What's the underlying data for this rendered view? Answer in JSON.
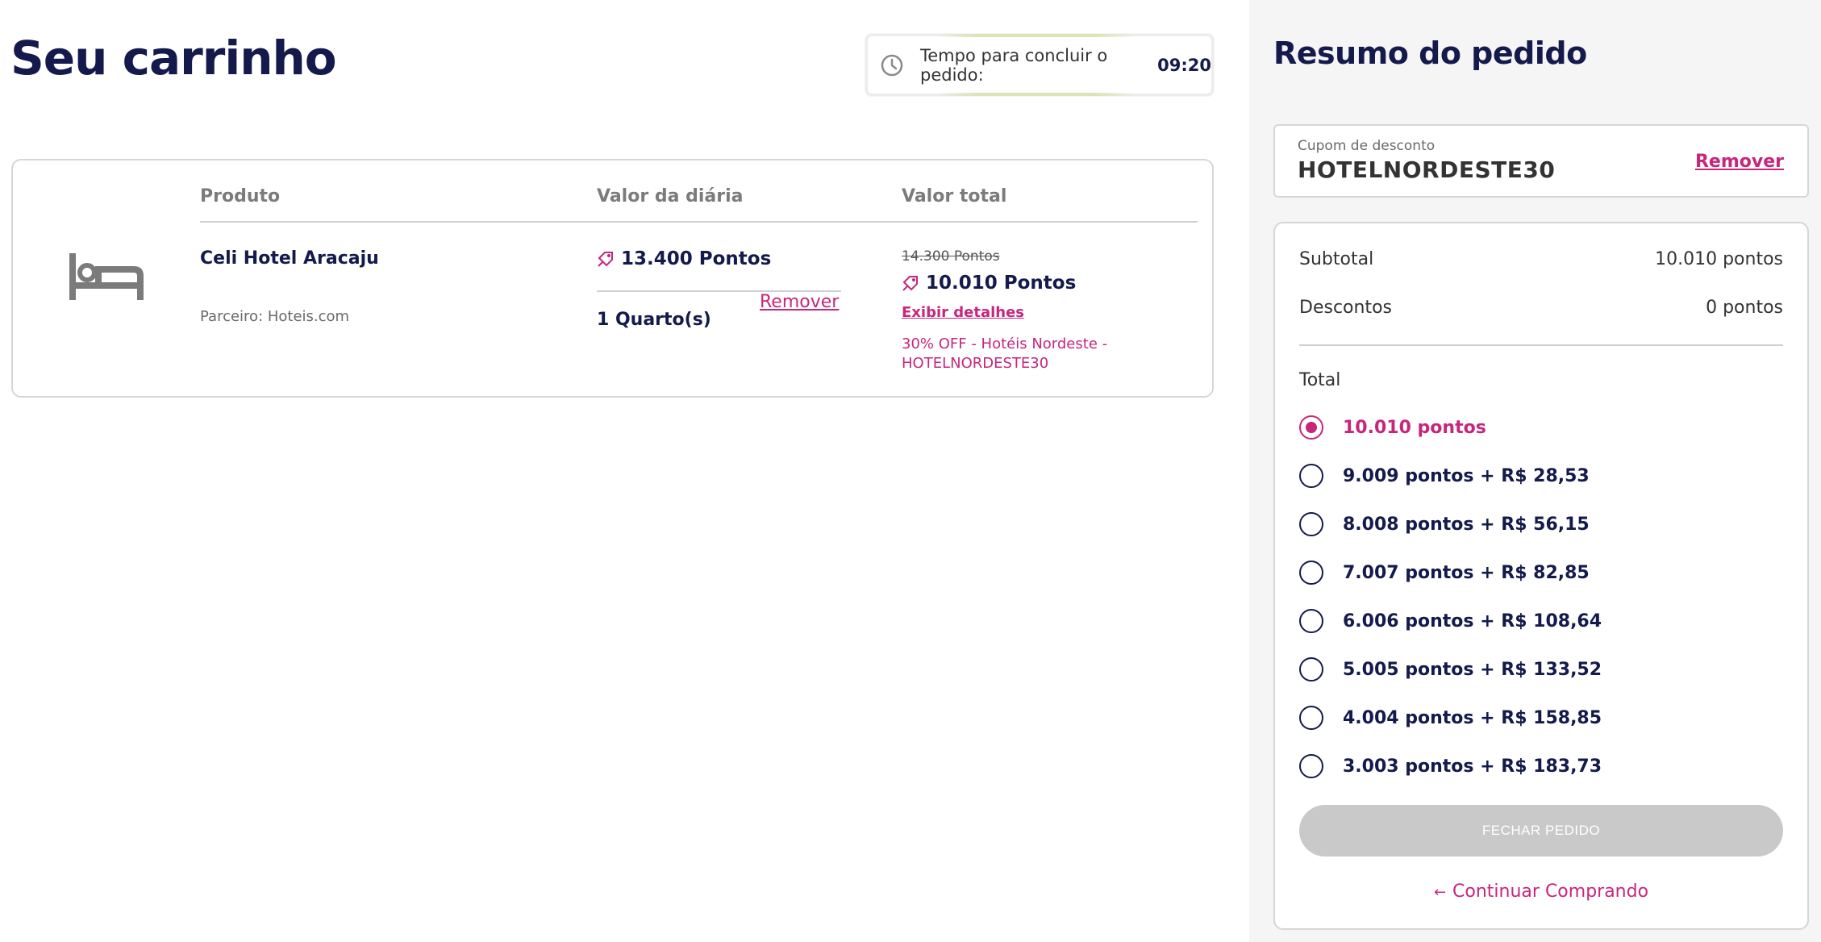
{
  "cart": {
    "title": "Seu carrinho",
    "timer_label": "Tempo para concluir o pedido:",
    "timer_value": "09:20",
    "columns": {
      "product": "Produto",
      "daily": "Valor da diária",
      "total": "Valor total"
    },
    "item": {
      "name": "Celi Hotel Aracaju",
      "partner": "Parceiro: Hoteis.com",
      "daily_price": "13.400 Pontos",
      "rooms": "1 Quarto(s)",
      "remove": "Remover",
      "old_price": "14.300 Pontos",
      "new_price": "10.010 Pontos",
      "details": "Exibir detalhes",
      "promo": "30% OFF - Hotéis Nordeste - HOTELNORDESTE30"
    }
  },
  "summary": {
    "title": "Resumo do pedido",
    "coupon_label": "Cupom de desconto",
    "coupon_code": "HOTELNORDESTE30",
    "coupon_remove": "Remover",
    "subtotal_label": "Subtotal",
    "subtotal_value": "10.010 pontos",
    "discount_label": "Descontos",
    "discount_value": "0 pontos",
    "total_label": "Total",
    "options": [
      "10.010 pontos",
      "9.009 pontos + R$ 28,53",
      "8.008 pontos + R$ 56,15",
      "7.007 pontos + R$ 82,85",
      "6.006 pontos + R$ 108,64",
      "5.005 pontos + R$ 133,52",
      "4.004 pontos + R$ 158,85",
      "3.003 pontos + R$ 183,73"
    ],
    "checkout": "FECHAR PEDIDO",
    "continue": "Continuar Comprando"
  },
  "colors": {
    "navy": "#141a4b",
    "magenta": "#c7267d",
    "disabled": "#c9c9c9"
  },
  "icons": [
    "clock-icon",
    "bed-icon",
    "points-icon",
    "arrow-left-icon"
  ]
}
